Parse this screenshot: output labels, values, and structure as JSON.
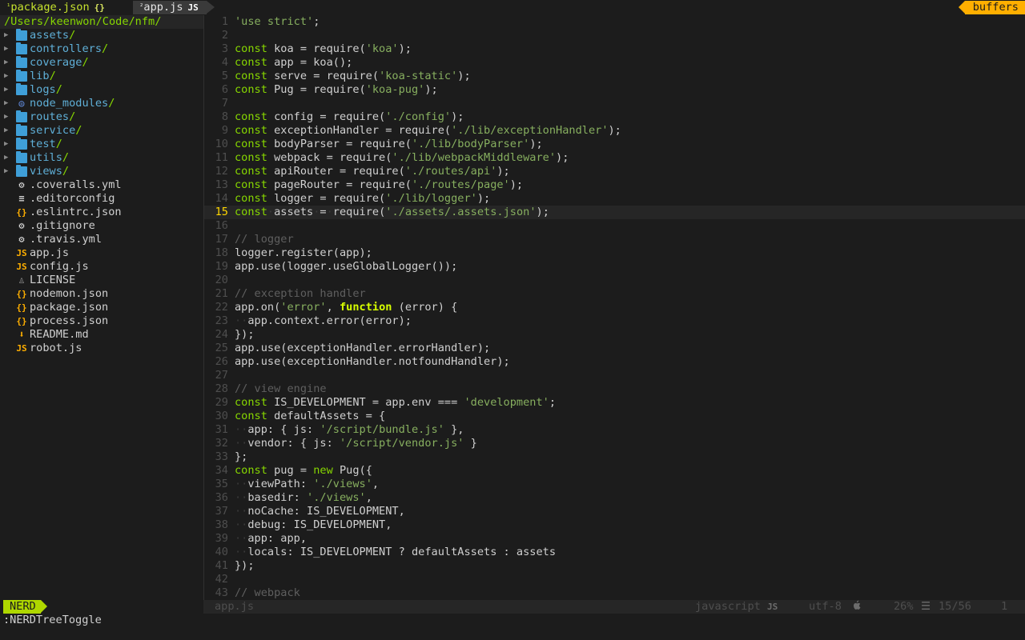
{
  "tabline": {
    "tab1": {
      "num": "¹",
      "name": "package.json",
      "ext": "{}"
    },
    "tab2": {
      "num": "²",
      "name": "app.js",
      "ext": "JS"
    },
    "buffers_label": "buffers"
  },
  "tree": {
    "root": "/Users/keenwon/Code/nfm/",
    "dirs": [
      {
        "name": "assets",
        "icon": "folder-icon"
      },
      {
        "name": "controllers",
        "icon": "folder-icon"
      },
      {
        "name": "coverage",
        "icon": "folder-icon"
      },
      {
        "name": "lib",
        "icon": "folder-icon"
      },
      {
        "name": "logs",
        "icon": "folder-icon"
      },
      {
        "name": "node_modules",
        "icon": "npm-icon"
      },
      {
        "name": "routes",
        "icon": "folder-icon"
      },
      {
        "name": "service",
        "icon": "folder-icon"
      },
      {
        "name": "test",
        "icon": "folder-icon"
      },
      {
        "name": "utils",
        "icon": "folder-icon"
      },
      {
        "name": "views",
        "icon": "folder-icon"
      }
    ],
    "files": [
      {
        "name": ".coveralls.yml",
        "icon": "gear-icon"
      },
      {
        "name": ".editorconfig",
        "icon": "lines-icon"
      },
      {
        "name": ".eslintrc.json",
        "icon": "json-icon"
      },
      {
        "name": ".gitignore",
        "icon": "gear-icon"
      },
      {
        "name": ".travis.yml",
        "icon": "gear-icon"
      },
      {
        "name": "app.js",
        "icon": "js-icon"
      },
      {
        "name": "config.js",
        "icon": "js-icon"
      },
      {
        "name": "LICENSE",
        "icon": "license-icon"
      },
      {
        "name": "nodemon.json",
        "icon": "json-icon"
      },
      {
        "name": "package.json",
        "icon": "json-icon"
      },
      {
        "name": "process.json",
        "icon": "json-icon"
      },
      {
        "name": "README.md",
        "icon": "markdown-icon"
      },
      {
        "name": "robot.js",
        "icon": "js-icon"
      }
    ]
  },
  "editor": {
    "current_line": 15,
    "lines": [
      [
        [
          "str",
          "'use strict'"
        ],
        [
          "p",
          ";"
        ]
      ],
      [],
      [
        [
          "kw",
          "const"
        ],
        [
          "p",
          " koa = require("
        ],
        [
          "str",
          "'koa'"
        ],
        [
          "p",
          ");"
        ]
      ],
      [
        [
          "kw",
          "const"
        ],
        [
          "p",
          " app = koa();"
        ]
      ],
      [
        [
          "kw",
          "const"
        ],
        [
          "p",
          " serve = require("
        ],
        [
          "str",
          "'koa-static'"
        ],
        [
          "p",
          ");"
        ]
      ],
      [
        [
          "kw",
          "const"
        ],
        [
          "p",
          " Pug = require("
        ],
        [
          "str",
          "'koa-pug'"
        ],
        [
          "p",
          ");"
        ]
      ],
      [],
      [
        [
          "kw",
          "const"
        ],
        [
          "p",
          " config = require("
        ],
        [
          "str",
          "'./config'"
        ],
        [
          "p",
          ");"
        ]
      ],
      [
        [
          "kw",
          "const"
        ],
        [
          "p",
          " exceptionHandler = require("
        ],
        [
          "str",
          "'./lib/exceptionHandler'"
        ],
        [
          "p",
          ");"
        ]
      ],
      [
        [
          "kw",
          "const"
        ],
        [
          "p",
          " bodyParser = require("
        ],
        [
          "str",
          "'./lib/bodyParser'"
        ],
        [
          "p",
          ");"
        ]
      ],
      [
        [
          "kw",
          "const"
        ],
        [
          "p",
          " webpack = require("
        ],
        [
          "str",
          "'./lib/webpackMiddleware'"
        ],
        [
          "p",
          ");"
        ]
      ],
      [
        [
          "kw",
          "const"
        ],
        [
          "p",
          " apiRouter = require("
        ],
        [
          "str",
          "'./routes/api'"
        ],
        [
          "p",
          ");"
        ]
      ],
      [
        [
          "kw",
          "const"
        ],
        [
          "p",
          " pageRouter = require("
        ],
        [
          "str",
          "'./routes/page'"
        ],
        [
          "p",
          ");"
        ]
      ],
      [
        [
          "kw",
          "const"
        ],
        [
          "p",
          " logger = require("
        ],
        [
          "str",
          "'./lib/logger'"
        ],
        [
          "p",
          ");"
        ]
      ],
      [
        [
          "kw",
          "const"
        ],
        [
          "ind",
          "·"
        ],
        [
          "p",
          "assets"
        ],
        [
          "ind",
          "·"
        ],
        [
          "p",
          "="
        ],
        [
          "ind",
          "·"
        ],
        [
          "p",
          "require("
        ],
        [
          "str",
          "'./assets/.assets.json'"
        ],
        [
          "p",
          ");"
        ]
      ],
      [],
      [
        [
          "cmt",
          "// logger"
        ]
      ],
      [
        [
          "p",
          "logger.register(app);"
        ]
      ],
      [
        [
          "p",
          "app.use(logger.useGlobalLogger());"
        ]
      ],
      [],
      [
        [
          "cmt",
          "// exception handler"
        ]
      ],
      [
        [
          "p",
          "app.on("
        ],
        [
          "str",
          "'error'"
        ],
        [
          "p",
          ", "
        ],
        [
          "fn",
          "function"
        ],
        [
          "p",
          " (error) {"
        ]
      ],
      [
        [
          "ind",
          "··"
        ],
        [
          "p",
          "app.context.error(error);"
        ]
      ],
      [
        [
          "p",
          "});"
        ]
      ],
      [
        [
          "p",
          "app.use(exceptionHandler.errorHandler);"
        ]
      ],
      [
        [
          "p",
          "app.use(exceptionHandler.notfoundHandler);"
        ]
      ],
      [],
      [
        [
          "cmt",
          "// view engine"
        ]
      ],
      [
        [
          "kw",
          "const"
        ],
        [
          "p",
          " IS_DEVELOPMENT = app.env === "
        ],
        [
          "str",
          "'development'"
        ],
        [
          "p",
          ";"
        ]
      ],
      [
        [
          "kw",
          "const"
        ],
        [
          "p",
          " defaultAssets = {"
        ]
      ],
      [
        [
          "ind",
          "··"
        ],
        [
          "p",
          "app: { js: "
        ],
        [
          "str",
          "'/script/bundle.js'"
        ],
        [
          "p",
          " },"
        ]
      ],
      [
        [
          "ind",
          "··"
        ],
        [
          "p",
          "vendor: { js: "
        ],
        [
          "str",
          "'/script/vendor.js'"
        ],
        [
          "p",
          " }"
        ]
      ],
      [
        [
          "p",
          "};"
        ]
      ],
      [
        [
          "kw",
          "const"
        ],
        [
          "p",
          " pug = "
        ],
        [
          "kw",
          "new"
        ],
        [
          "p",
          " Pug({"
        ]
      ],
      [
        [
          "ind",
          "··"
        ],
        [
          "p",
          "viewPath: "
        ],
        [
          "str",
          "'./views'"
        ],
        [
          "p",
          ","
        ]
      ],
      [
        [
          "ind",
          "··"
        ],
        [
          "p",
          "basedir: "
        ],
        [
          "str",
          "'./views'"
        ],
        [
          "p",
          ","
        ]
      ],
      [
        [
          "ind",
          "··"
        ],
        [
          "p",
          "noCache: IS_DEVELOPMENT,"
        ]
      ],
      [
        [
          "ind",
          "··"
        ],
        [
          "p",
          "debug: IS_DEVELOPMENT,"
        ]
      ],
      [
        [
          "ind",
          "··"
        ],
        [
          "p",
          "app: app,"
        ]
      ],
      [
        [
          "ind",
          "··"
        ],
        [
          "p",
          "locals: IS_DEVELOPMENT ? defaultAssets : assets"
        ]
      ],
      [
        [
          "p",
          "});"
        ]
      ],
      [],
      [
        [
          "cmt",
          "// webpack"
        ]
      ]
    ]
  },
  "statusline": {
    "mode": "NERD",
    "file": "app.js",
    "filetype": "javascript",
    "filetype_icon": "JS",
    "encoding": "utf-8",
    "os_icon": "apple-icon",
    "percent": "26%",
    "position": "15/56",
    "column": "1"
  },
  "cmdline": ":NERDTreeToggle",
  "colors": {
    "keyword": "#87d700",
    "string": "#87af5f",
    "comment": "#5f5f5f",
    "mode_bg": "#afd700",
    "buffers_bg": "#ffaf00",
    "cursor_line_number": "#ffd700"
  }
}
